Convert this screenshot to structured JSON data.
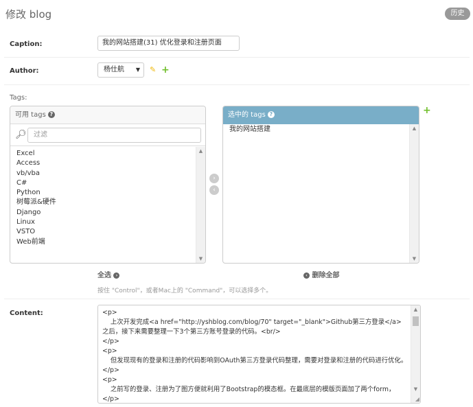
{
  "header": {
    "title": "修改 blog",
    "history_label": "历史"
  },
  "caption": {
    "label": "Caption:",
    "value": "我的网站搭建(31) 优化登录和注册页面"
  },
  "author": {
    "label": "Author:",
    "selected": "杨仕航"
  },
  "tags": {
    "label": "Tags:",
    "available_title": "可用 tags",
    "filter_placeholder": "过滤",
    "available_items": [
      "Excel",
      "Access",
      "vb/vba",
      "C#",
      "Python",
      "树莓派&硬件",
      "Django",
      "Linux",
      "VSTO",
      "Web前端"
    ],
    "chosen_title": "选中的 tags",
    "chosen_items": [
      "我的网站搭建"
    ],
    "choose_all_label": "全选",
    "remove_all_label": "删除全部",
    "help_text": "按住 \"Control\"，或者Mac上的 \"Command\"，可以选择多个。"
  },
  "content": {
    "label": "Content:",
    "value": "<p>\n    上次开发完成<a href=\"http://yshblog.com/blog/70\" target=\"_blank\">Github第三方登录</a>之后，接下来需要整理一下3个第三方账号登录的代码。<br/>\n</p>\n<p>\n    但发现现有的登录和注册的代码影响到OAuth第三方登录代码整理，需要对登录和注册的代码进行优化。\n</p>\n<p>\n    之前写的登录、注册为了图方便就利用了Bootstrap的模态框。在最底层的模版页面加了两个form，\n</p>"
  },
  "icons": {
    "help": "question-circle-icon",
    "search": "magnifier-icon",
    "edit": "pencil-icon",
    "add": "plus-icon",
    "move_right": "arrow-right-icon",
    "move_left": "arrow-left-icon"
  },
  "colors": {
    "chosen_header": "#79aec8",
    "add_green": "#70bf2b",
    "edit_yellow": "#efb80b",
    "history_button": "#999999"
  }
}
